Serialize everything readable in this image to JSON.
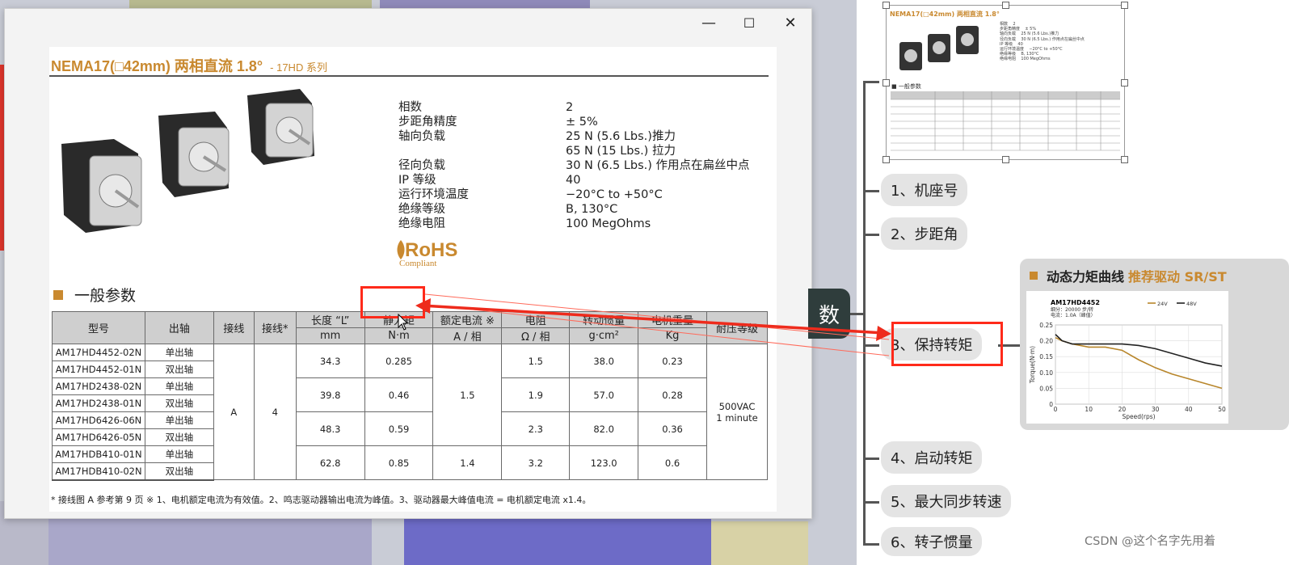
{
  "viewer": {
    "controls": {
      "minimize": "—",
      "maximize": "☐",
      "close": "✕"
    },
    "doc": {
      "title": "NEMA17(□42mm) 两相直流 1.8°",
      "series": "- 17HD 系列",
      "specs": [
        {
          "k": "相数",
          "v": "2"
        },
        {
          "k": "步距角精度",
          "v": "± 5%"
        },
        {
          "k": "轴向负载",
          "v": "25 N (5.6 Lbs.)推力\n65 N (15 Lbs.) 拉力"
        },
        {
          "k": "径向负载",
          "v": "30 N (6.5 Lbs.) 作用点在扁丝中点"
        },
        {
          "k": "IP 等级",
          "v": "40"
        },
        {
          "k": "运行环境温度",
          "v": "−20°C to +50°C"
        },
        {
          "k": "绝缘等级",
          "v": "B, 130°C"
        },
        {
          "k": "绝缘电阻",
          "v": "100 MegOhms"
        }
      ],
      "rohs": {
        "main": "RoHS",
        "sub": "Compliant"
      },
      "section_title": "一般参数",
      "table": {
        "headers_top": [
          "型号",
          "出轴",
          "接线",
          "接线*",
          "长度 “L”",
          "静力矩",
          "额定电流 ※",
          "电阻",
          "转动惯量",
          "电机重量",
          "耐压等级"
        ],
        "headers_unit": [
          "mm",
          "N·m",
          "A / 相",
          "Ω / 相",
          "g·cm²",
          "Kg"
        ],
        "models": [
          {
            "model": "AM17HD4452-02N",
            "shaft": "单出轴"
          },
          {
            "model": "AM17HD4452-01N",
            "shaft": "双出轴"
          },
          {
            "model": "AM17HD2438-02N",
            "shaft": "单出轴"
          },
          {
            "model": "AM17HD2438-01N",
            "shaft": "双出轴"
          },
          {
            "model": "AM17HD6426-06N",
            "shaft": "单出轴"
          },
          {
            "model": "AM17HD6426-05N",
            "shaft": "双出轴"
          },
          {
            "model": "AM17HDB410-01N",
            "shaft": "单出轴"
          },
          {
            "model": "AM17HDB410-02N",
            "shaft": "双出轴"
          }
        ],
        "wiring": "A",
        "wiring2": "4",
        "groups": [
          {
            "length": "34.3",
            "torque": "0.285",
            "resistance": "1.5",
            "inertia": "38.0",
            "weight": "0.23"
          },
          {
            "length": "39.8",
            "torque": "0.46",
            "resistance": "1.9",
            "inertia": "57.0",
            "weight": "0.28"
          },
          {
            "length": "48.3",
            "torque": "0.59",
            "resistance": "2.3",
            "inertia": "82.0",
            "weight": "0.36"
          },
          {
            "length": "62.8",
            "torque": "0.85",
            "resistance": "3.2",
            "inertia": "123.0",
            "weight": "0.6"
          }
        ],
        "current_a": "1.5",
        "current_b": "1.4",
        "voltage_rating": "500VAC\n1 minute"
      },
      "footnote": "* 接线图 A 参考第 9 页   ※ 1、电机额定电流为有效值。2、鸣志驱动器输出电流为峰值。3、驱动器最大峰值电流 = 电机额定电流 x1.4。"
    }
  },
  "mindmap": {
    "central": "数",
    "nodes": [
      "1、机座号",
      "2、步距角",
      "3、保持转矩",
      "4、启动转矩",
      "5、最大同步转速",
      "6、转子惯量"
    ],
    "thumb_title": "NEMA17(□42mm) 两相直流 1.8°",
    "thumb_section": "一般参数",
    "torque_card": {
      "title": "动态力矩曲线",
      "accent": "推荐驱动 SR/ST",
      "model": "AM17HD4452",
      "settings": "细分：20000 步/转\n电流：1.0A（峰值）",
      "legend": [
        "24V",
        "48V"
      ],
      "ylabel": "Torque(N·m)",
      "xlabel": "Speed(rps)",
      "xticks": [
        "0",
        "10",
        "20",
        "30",
        "40",
        "50"
      ],
      "yticks": [
        "0",
        "0.05",
        "0.10",
        "0.15",
        "0.20",
        "0.25"
      ]
    }
  },
  "chart_data": {
    "type": "line",
    "title": "AM17HD4452",
    "xlabel": "Speed(rps)",
    "ylabel": "Torque(N·m)",
    "xlim": [
      0,
      50
    ],
    "ylim": [
      0,
      0.25
    ],
    "series": [
      {
        "name": "24V",
        "color": "#b8862b",
        "x": [
          0,
          2,
          5,
          10,
          15,
          20,
          25,
          30,
          35,
          40,
          45,
          50
        ],
        "y": [
          0.21,
          0.2,
          0.19,
          0.18,
          0.18,
          0.17,
          0.14,
          0.115,
          0.095,
          0.08,
          0.065,
          0.05
        ]
      },
      {
        "name": "48V",
        "color": "#222222",
        "x": [
          0,
          2,
          5,
          10,
          15,
          20,
          25,
          30,
          35,
          40,
          45,
          50
        ],
        "y": [
          0.22,
          0.2,
          0.19,
          0.19,
          0.19,
          0.19,
          0.185,
          0.175,
          0.16,
          0.145,
          0.13,
          0.12
        ]
      }
    ],
    "grid": true,
    "legend": "top-right"
  },
  "watermark": "CSDN @这个名字先用着"
}
